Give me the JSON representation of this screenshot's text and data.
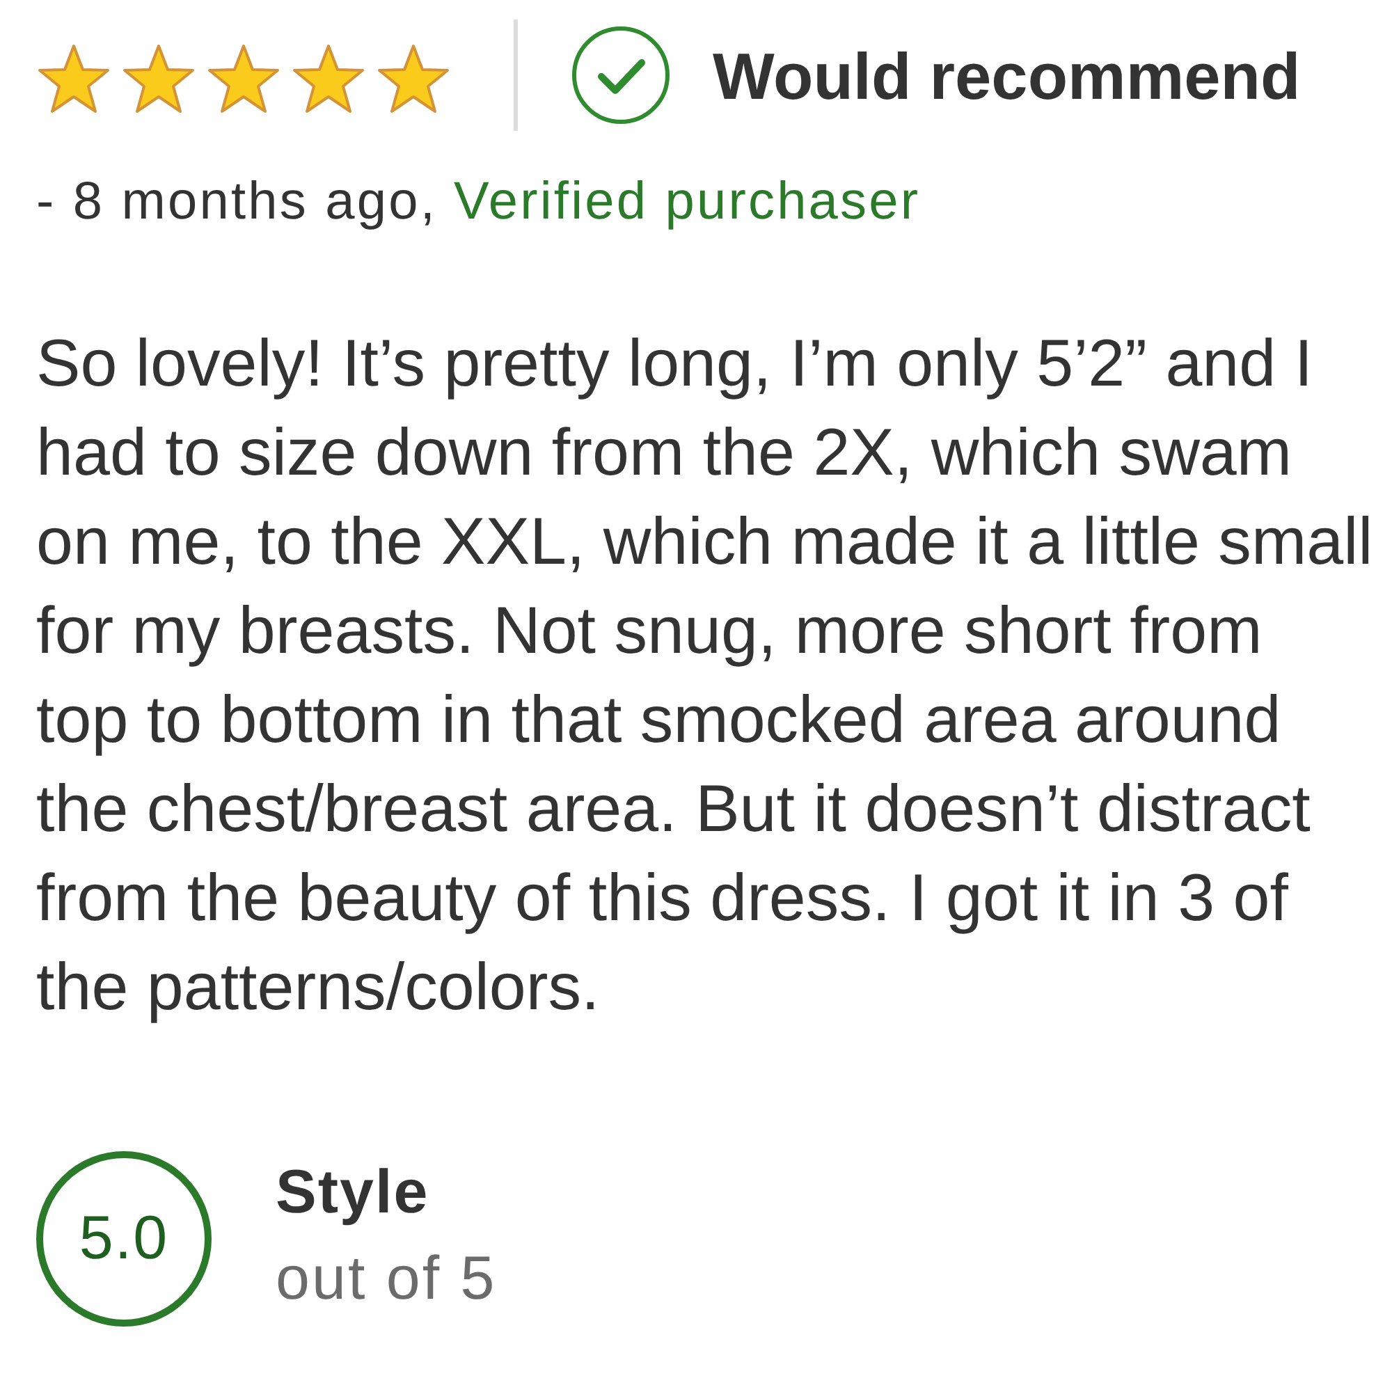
{
  "review": {
    "stars": 5,
    "recommendation": "Would recommend",
    "posted": "- 8 months ago,",
    "verified": "Verified purchaser",
    "body_lines": [
      "So lovely! It’s pretty long, I’m only 5’2” and I",
      "had to size down from the 2X, which swam",
      "on me, to the XXL, which made it a little small",
      "for my breasts. Not snug, more short from",
      "top to bottom in that smocked area around",
      "the chest/breast area. But it doesn’t distract",
      "from the beauty of this dress. I got it in 3 of",
      "the patterns/colors."
    ]
  },
  "ratings": [
    {
      "score": "5.0",
      "label": "Style",
      "scale": "out of 5"
    }
  ]
}
